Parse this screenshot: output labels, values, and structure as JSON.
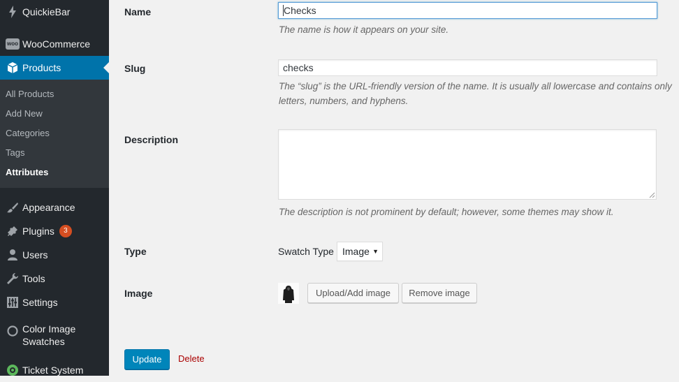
{
  "sidebar": {
    "items": [
      {
        "label": "QuickieBar",
        "icon": "bolt-icon"
      },
      {
        "label": "WooCommerce",
        "icon": "woocommerce-icon",
        "icon_text": "woo"
      },
      {
        "label": "Products",
        "icon": "archive-box-icon"
      },
      {
        "label": "Appearance",
        "icon": "paintbrush-icon"
      },
      {
        "label": "Plugins",
        "icon": "plugin-icon",
        "badge": "3"
      },
      {
        "label": "Users",
        "icon": "user-icon"
      },
      {
        "label": "Tools",
        "icon": "wrench-icon"
      },
      {
        "label": "Settings",
        "icon": "settings-sliders-icon"
      },
      {
        "label_line1": "Color Image",
        "label_line2": "Swatches",
        "icon": "color-swatch-icon"
      },
      {
        "label": "Ticket System",
        "icon": "ticket-system-icon"
      }
    ],
    "submenu": [
      "All Products",
      "Add New",
      "Categories",
      "Tags",
      "Attributes"
    ],
    "active_submenu": "Attributes",
    "colors": {
      "bg": "#23282d",
      "active": "#0073aa",
      "submenu_bg": "#32373c"
    }
  },
  "form": {
    "name": {
      "label": "Name",
      "value": "Checks",
      "description": "The name is how it appears on your site."
    },
    "slug": {
      "label": "Slug",
      "value": "checks",
      "description_line1": "The “slug” is the URL-friendly version of the name. It is usually all lowercase and contains only",
      "description_line2": "letters, numbers, and hyphens."
    },
    "description": {
      "label": "Description",
      "value": "",
      "help": "The description is not prominent by default; however, some themes may show it."
    },
    "type": {
      "label": "Type",
      "swatch_label": "Swatch Type",
      "selected": "Image"
    },
    "image": {
      "label": "Image",
      "upload_label": "Upload/Add image",
      "remove_label": "Remove image",
      "thumbnail_icon": "hoodie-thumbnail"
    },
    "update_label": "Update",
    "delete_label": "Delete"
  }
}
